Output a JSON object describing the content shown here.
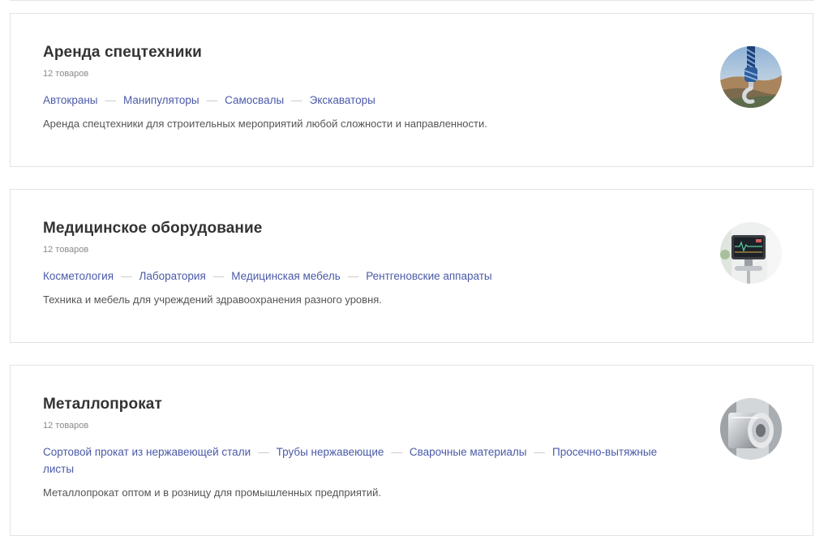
{
  "categories": [
    {
      "title": "Аренда спецтехники",
      "count": "12 товаров",
      "links": [
        "Автокраны",
        "Манипуляторы",
        "Самосвалы",
        "Экскаваторы"
      ],
      "description": "Аренда спецтехники для строительных мероприятий любой сложности и направленности.",
      "image_icon": "crane-hook-icon"
    },
    {
      "title": "Медицинское оборудование",
      "count": "12 товаров",
      "links": [
        "Косметология",
        "Лаборатория",
        "Медицинская мебель",
        "Рентгеновские аппараты"
      ],
      "description": "Техника и мебель для учреждений здравоохранения разного уровня.",
      "image_icon": "medical-monitor-icon"
    },
    {
      "title": "Металлопрокат",
      "count": "12 товаров",
      "links": [
        "Сортовой прокат из нержавеющей стали",
        "Трубы нержавеющие",
        "Сварочные материалы",
        "Просечно-вытяжные листы"
      ],
      "description": "Металлопрокат оптом и в розницу для промышленных предприятий.",
      "image_icon": "metal-roll-icon"
    }
  ],
  "colors": {
    "link": "#4a5aa8",
    "title": "#333333",
    "muted": "#8a8a8a",
    "border": "#e3e3e3"
  }
}
